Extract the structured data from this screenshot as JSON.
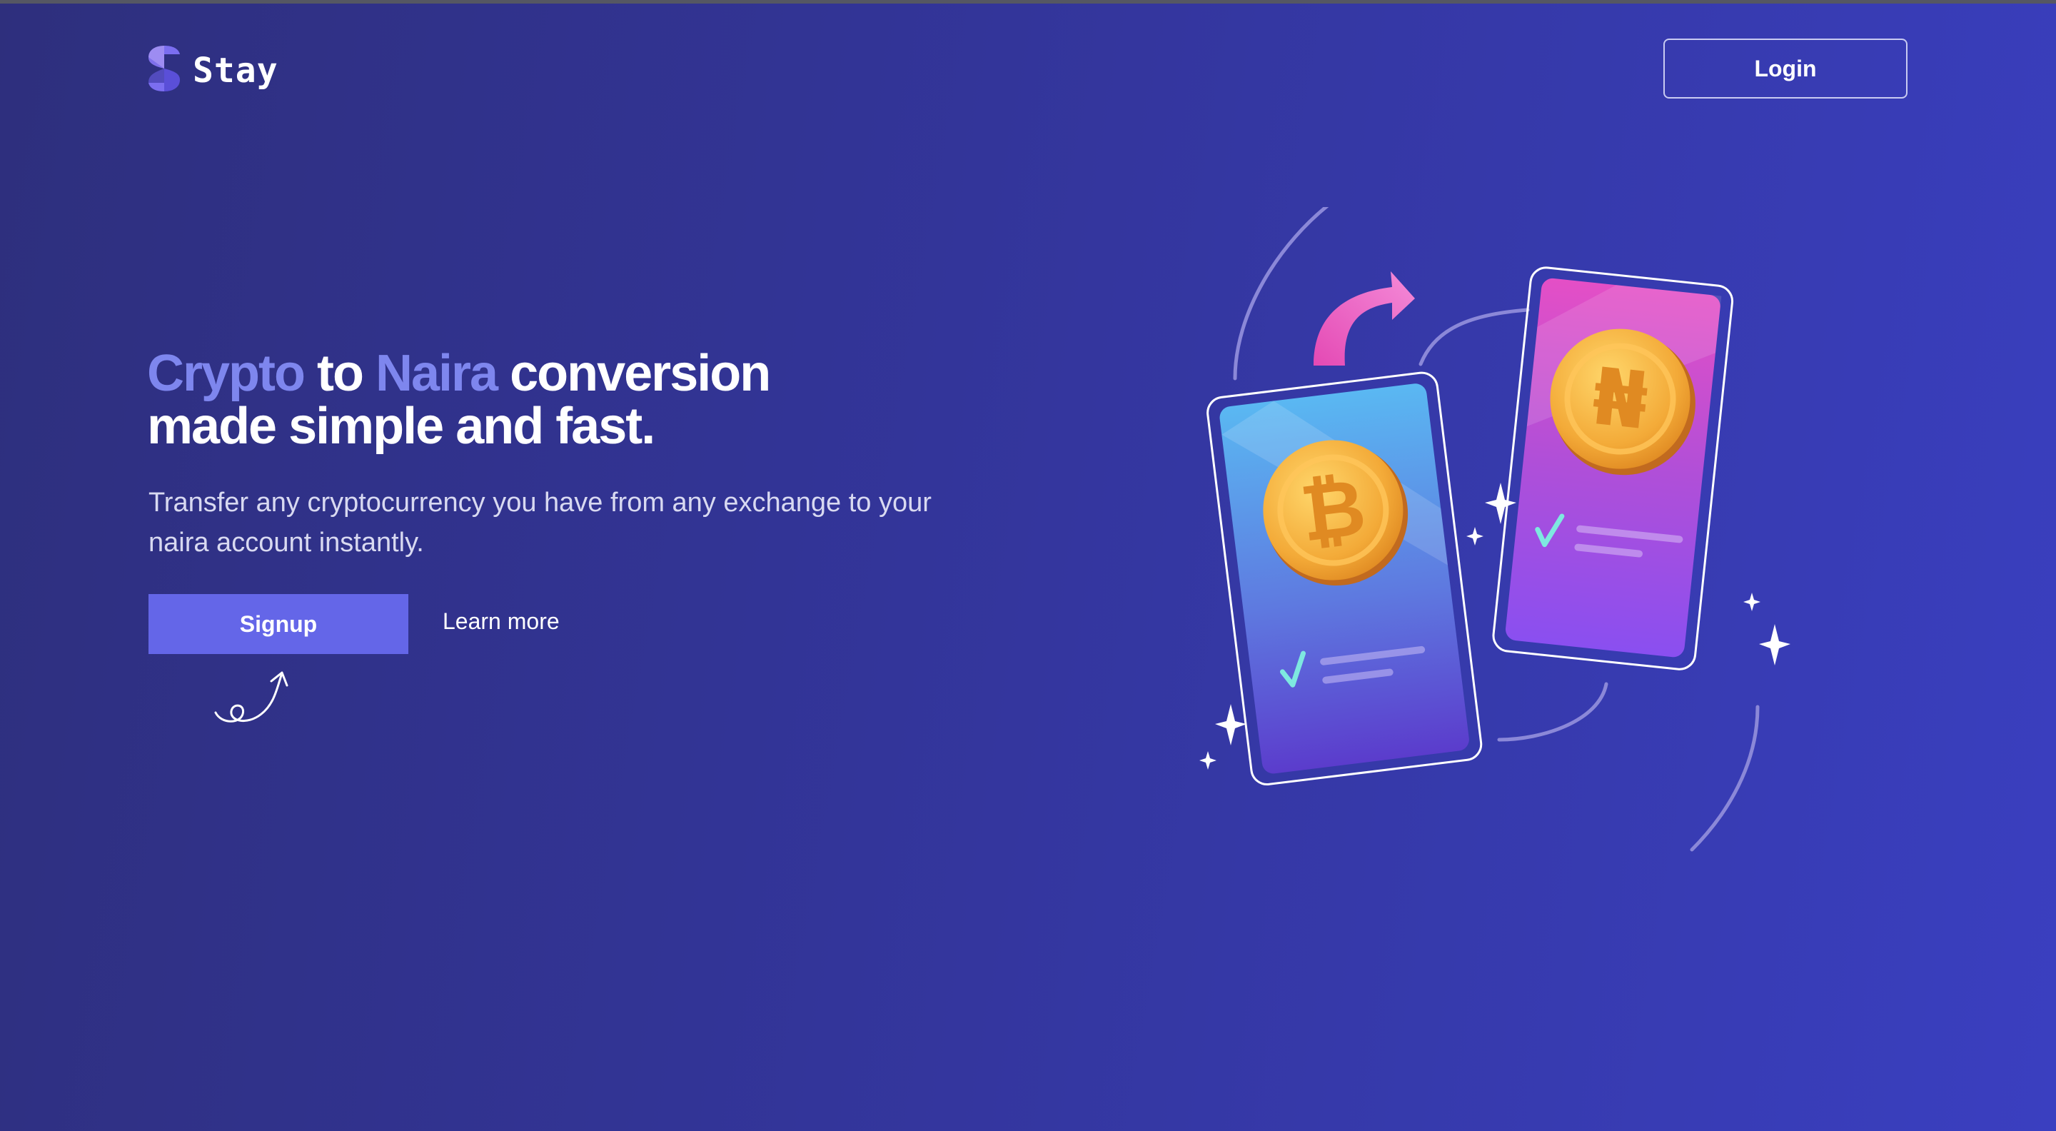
{
  "header": {
    "brand": "Stay",
    "login_label": "Login"
  },
  "hero": {
    "title_word_1": "Crypto",
    "title_word_2": " to ",
    "title_word_3": "Naira",
    "title_word_4": " conversion",
    "title_line_2": "made simple and fast.",
    "subtitle_line_1": "Transfer any cryptocurrency you have from any exchange to your",
    "subtitle_line_2": "naira account instantly.",
    "signup_label": "Signup",
    "learn_more_label": "Learn more"
  },
  "colors": {
    "accent": "#7e86ee",
    "button": "#6466e8",
    "background_start": "#2e2f7d",
    "background_end": "#3a3fc0"
  },
  "icons": {
    "logo": "stay-logo-icon",
    "squiggle": "squiggle-arrow-icon",
    "bitcoin": "bitcoin-coin-icon",
    "naira": "naira-coin-icon"
  }
}
